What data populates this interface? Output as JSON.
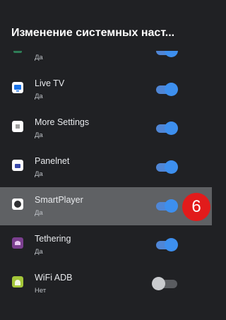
{
  "header": {
    "title": "Изменение системных наст..."
  },
  "apps": [
    {
      "name": "",
      "status": "Да",
      "enabled": true,
      "icon": "green-app-icon"
    },
    {
      "name": "Live TV",
      "status": "Да",
      "enabled": true,
      "icon": "live-tv-icon"
    },
    {
      "name": "More Settings",
      "status": "Да",
      "enabled": true,
      "icon": "more-settings-icon"
    },
    {
      "name": "Panelnet",
      "status": "Да",
      "enabled": true,
      "icon": "panelnet-icon"
    },
    {
      "name": "SmartPlayer",
      "status": "Да",
      "enabled": true,
      "icon": "smartplayer-icon",
      "focused": true,
      "badge": "6"
    },
    {
      "name": "Tethering",
      "status": "Да",
      "enabled": true,
      "icon": "tethering-icon"
    },
    {
      "name": "WiFi ADB",
      "status": "Нет",
      "enabled": false,
      "icon": "android-icon"
    }
  ],
  "colors": {
    "background": "#202124",
    "focused_row": "#5f6164",
    "toggle_on": "#3d8fee",
    "toggle_off": "#c9cbce",
    "badge": "#e21b1b"
  }
}
